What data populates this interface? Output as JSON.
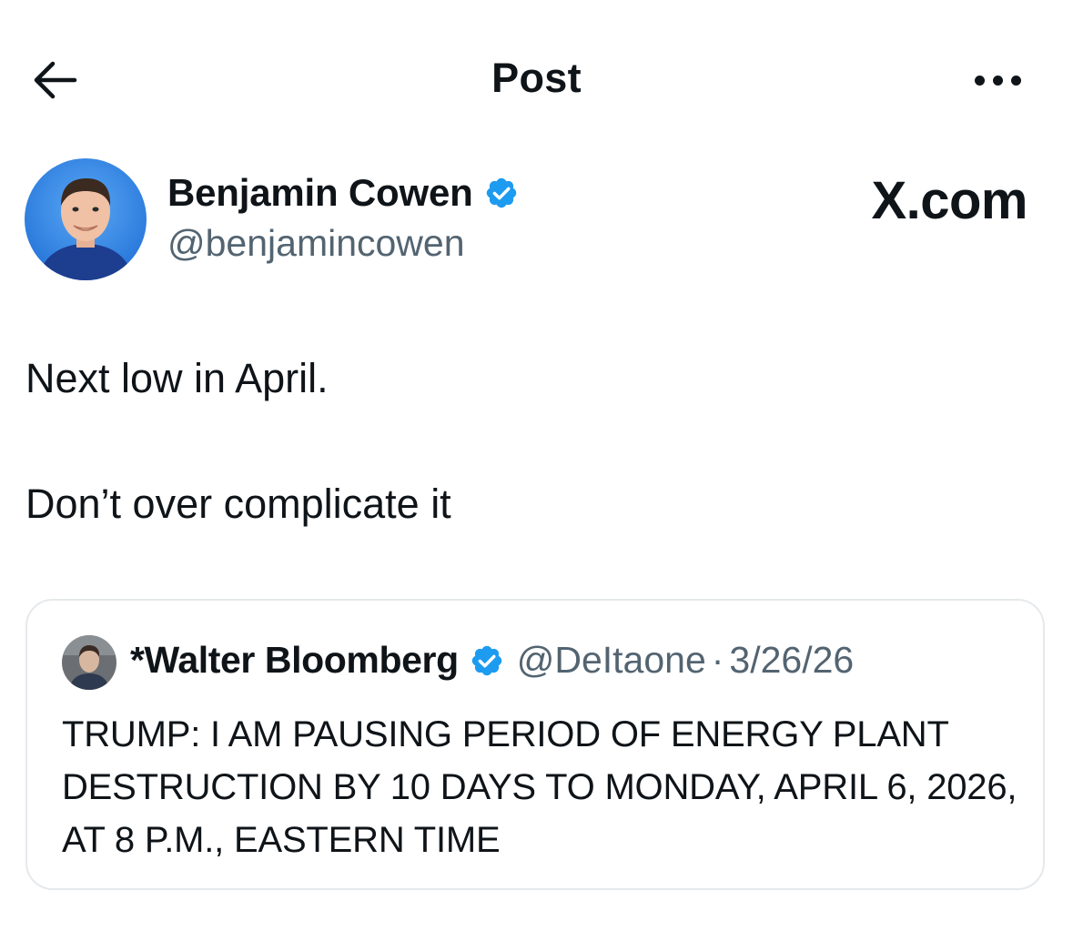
{
  "header": {
    "title": "Post",
    "back_icon": "arrow-left-icon",
    "more_icon": "more-horizontal-icon"
  },
  "author": {
    "name": "Benjamin Cowen",
    "handle": "@benjamincowen",
    "verified": true,
    "badge_color": "#1d9bf0"
  },
  "watermark": "X.com",
  "post": {
    "lines": [
      "Next low in April.",
      "Don’t over complicate it"
    ]
  },
  "quoted_post": {
    "name": "*Walter Bloomberg",
    "verified": true,
    "handle": "@DeItaone",
    "separator": "·",
    "date": "3/26/26",
    "text": "TRUMP: I AM PAUSING PERIOD OF ENERGY PLANT DESTRUCTION BY 10 DAYS TO MONDAY, APRIL 6, 2026, AT 8 P.M., EASTERN TIME"
  },
  "colors": {
    "text_primary": "#0f1419",
    "text_secondary": "#536471",
    "border": "#e6e9ec",
    "avatar_bg": "#2a7fe0"
  }
}
